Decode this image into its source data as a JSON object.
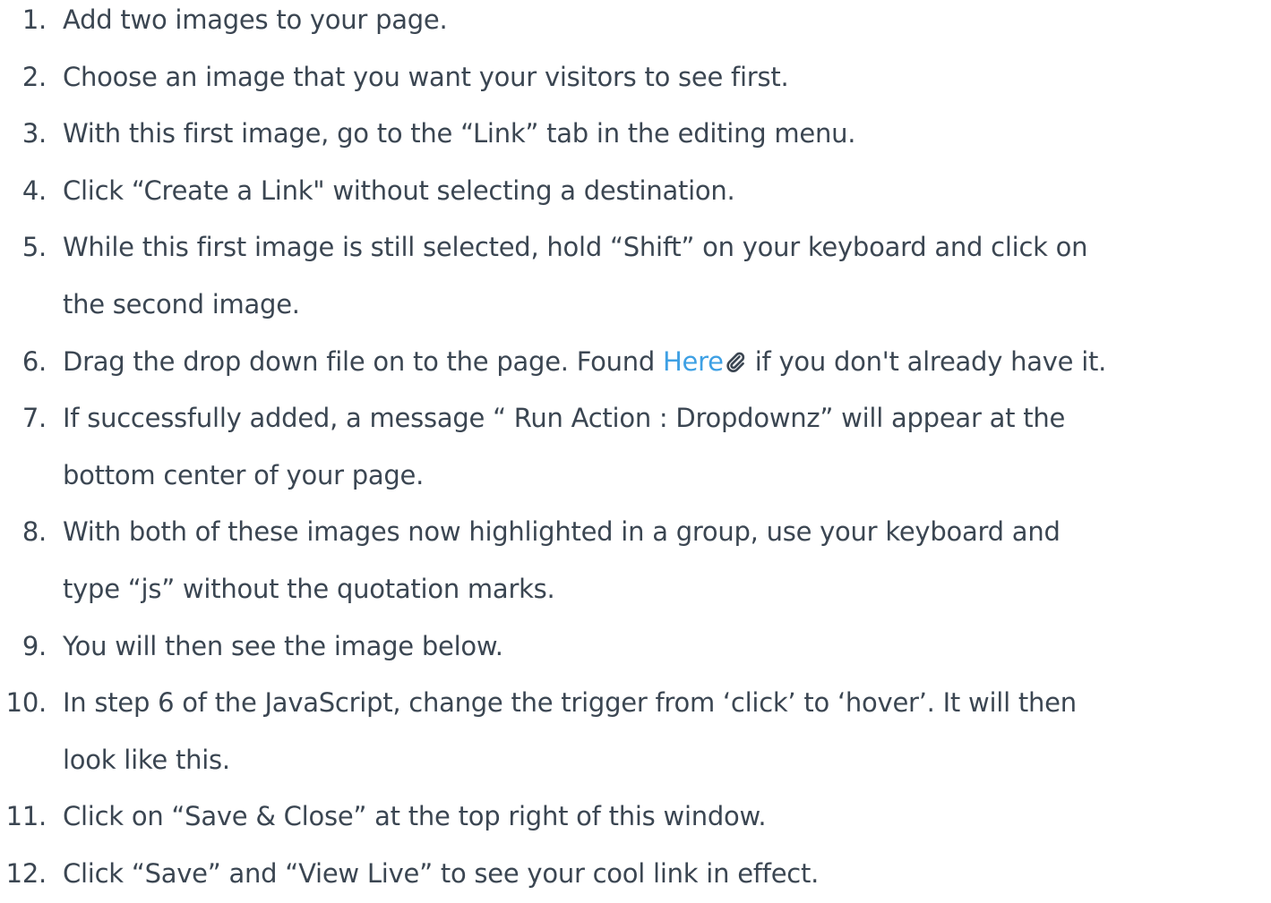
{
  "steps": [
    {
      "number": "1.",
      "lines": [
        "Add two images to your page."
      ]
    },
    {
      "number": "2.",
      "lines": [
        "Choose an image that you want your visitors to see first."
      ]
    },
    {
      "number": "3.",
      "lines": [
        "With this first image, go to the “Link” tab in the editing menu."
      ]
    },
    {
      "number": "4.",
      "lines": [
        "Click “Create a Link\" without selecting a destination."
      ]
    },
    {
      "number": "5.",
      "lines": [
        "While this first image is still selected, hold “Shift” on your keyboard and click on",
        "the second image."
      ]
    },
    {
      "number": "6.",
      "before_link": "Drag the drop down file on to the page. Found ",
      "link_text": "Here",
      "link_icon": "paperclip-icon",
      "after_link": " if you don't already have it."
    },
    {
      "number": "7.",
      "lines": [
        "If successfully added, a message “ Run Action : Dropdownz” will appear at the",
        "bottom center of your page."
      ]
    },
    {
      "number": "8.",
      "lines": [
        "With both of these images now highlighted in a group, use your keyboard and",
        "type “js” without the quotation marks."
      ]
    },
    {
      "number": "9.",
      "lines": [
        "You will then see the image below."
      ]
    },
    {
      "number": "10.",
      "lines": [
        "In step 6 of the JavaScript, change the trigger from ‘click’ to ‘hover’. It will then",
        "look like this."
      ]
    },
    {
      "number": "11.",
      "lines": [
        "Click on “Save & Close” at the top right of this window."
      ]
    },
    {
      "number": "12.",
      "lines": [
        "Click “Save” and “View Live” to see your cool link in effect."
      ]
    }
  ],
  "colors": {
    "text": "#3b4652",
    "link": "#3ea0e4"
  }
}
